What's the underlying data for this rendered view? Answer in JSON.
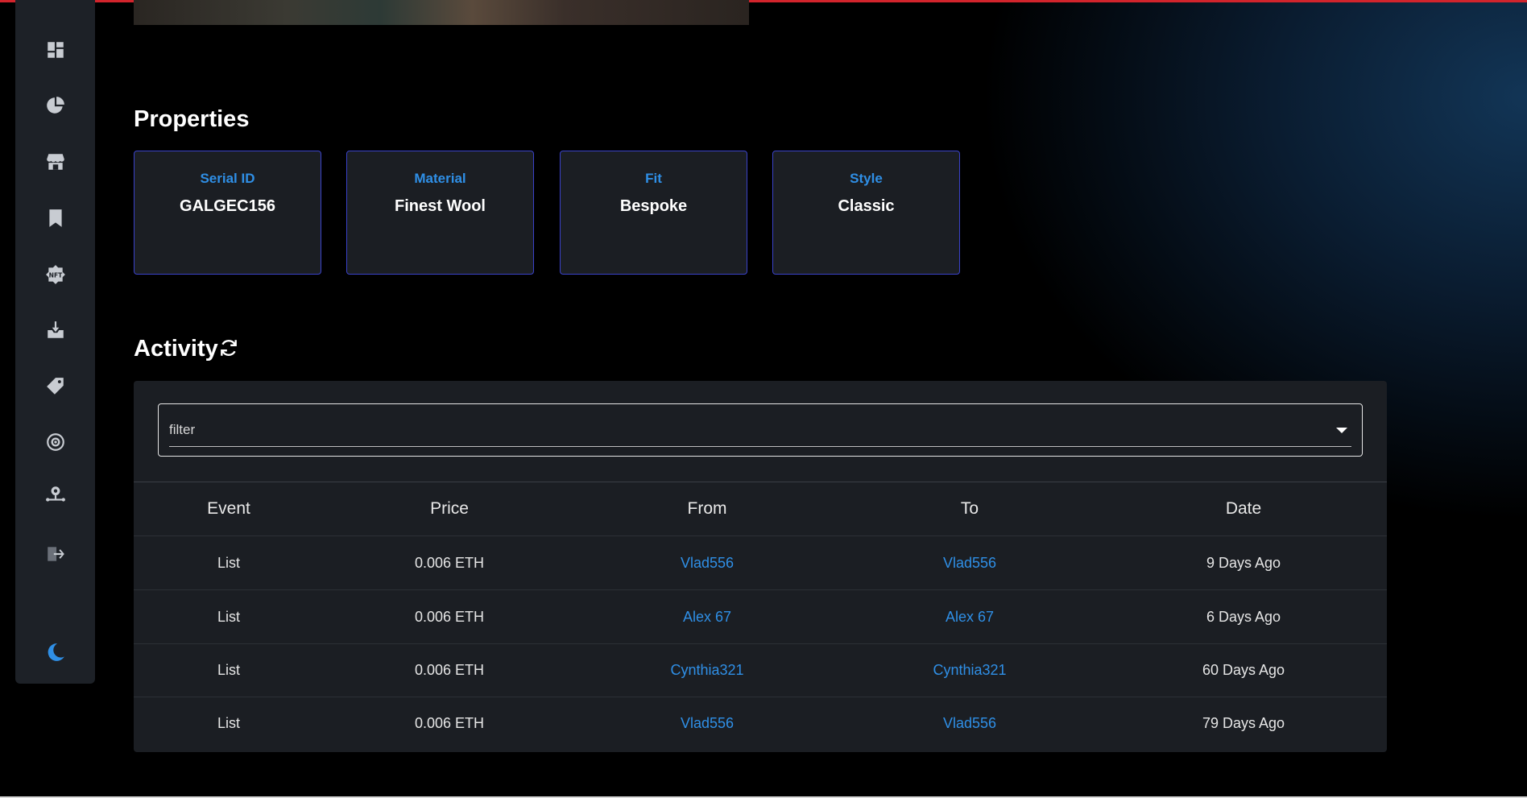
{
  "colors": {
    "accent": "#2f8fe6",
    "card_border": "#3a42c9",
    "panel_bg": "#1b1e23",
    "sidebar_bg": "#1d2127",
    "top_bar": "#d2242c"
  },
  "sidebar": {
    "items": [
      {
        "icon": "dashboard-icon"
      },
      {
        "icon": "pie-chart-icon"
      },
      {
        "icon": "storefront-icon"
      },
      {
        "icon": "bookmark-icon"
      },
      {
        "icon": "nft-icon"
      },
      {
        "icon": "inbox-download-icon"
      },
      {
        "icon": "price-tag-icon"
      },
      {
        "icon": "settings-cycle-icon"
      },
      {
        "icon": "network-node-icon"
      },
      {
        "icon": "logout-icon"
      }
    ],
    "theme_toggle_icon": "moon-icon"
  },
  "properties": {
    "title": "Properties",
    "cards": [
      {
        "label": "Serial ID",
        "value": "GALGEC156"
      },
      {
        "label": "Material",
        "value": "Finest Wool"
      },
      {
        "label": "Fit",
        "value": "Bespoke"
      },
      {
        "label": "Style",
        "value": "Classic"
      }
    ]
  },
  "activity": {
    "title": "Activity",
    "refresh_icon": "refresh-icon",
    "filter": {
      "value": "filter"
    },
    "columns": [
      "Event",
      "Price",
      "From",
      "To",
      "Date"
    ],
    "rows": [
      {
        "event": "List",
        "price": "0.006 ETH",
        "from": "Vlad556",
        "to": "Vlad556",
        "date": "9 Days Ago"
      },
      {
        "event": "List",
        "price": "0.006 ETH",
        "from": "Alex 67",
        "to": "Alex 67",
        "date": "6 Days Ago"
      },
      {
        "event": "List",
        "price": "0.006 ETH",
        "from": "Cynthia321",
        "to": "Cynthia321",
        "date": "60 Days Ago"
      },
      {
        "event": "List",
        "price": "0.006 ETH",
        "from": "Vlad556",
        "to": "Vlad556",
        "date": "79 Days Ago"
      }
    ]
  }
}
